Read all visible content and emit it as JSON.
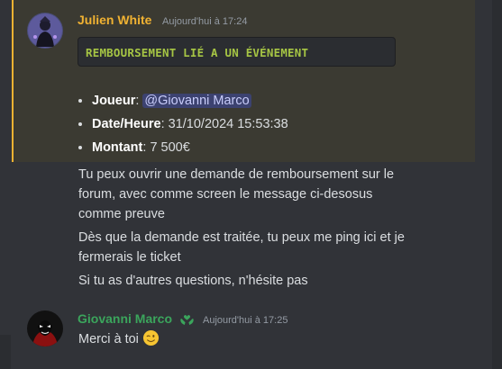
{
  "messages": [
    {
      "author": "Julien White",
      "author_color": "#f0b232",
      "timestamp": "Aujourd'hui à 17:24",
      "code_block": "REMBOURSEMENT LIÉ A UN ÉVÉNEMENT",
      "details": [
        {
          "label": "Joueur",
          "sep": ": ",
          "mention": "@Giovanni Marco"
        },
        {
          "label": "Date/Heure",
          "sep": ": ",
          "value": "31/10/2024 15:53:38"
        },
        {
          "label": "Montant",
          "sep": ": ",
          "value": "7 500€"
        }
      ]
    },
    {
      "lines": [
        "Tu peux ouvrir une demande de remboursement sur le",
        "forum, avec comme screen le message ci-desosus",
        "comme preuve",
        "Dès que la demande est traitée, tu peux me ping ici et je",
        "fermerais le ticket",
        "Si tu as d'autres questions, n'hésite pas"
      ]
    },
    {
      "author": "Giovanni Marco",
      "author_color": "#3ba55c",
      "badge_icon": "hands-heart-icon",
      "timestamp": "Aujourd'hui à 17:25",
      "text": "Merci à toi",
      "emoji": "winking-face-emoji"
    }
  ],
  "colors": {
    "background": "#313338",
    "highlight": "#3b3a32",
    "highlight_border": "#f0b232",
    "code_text": "#a6c544",
    "mention_bg": "#3c4270"
  }
}
